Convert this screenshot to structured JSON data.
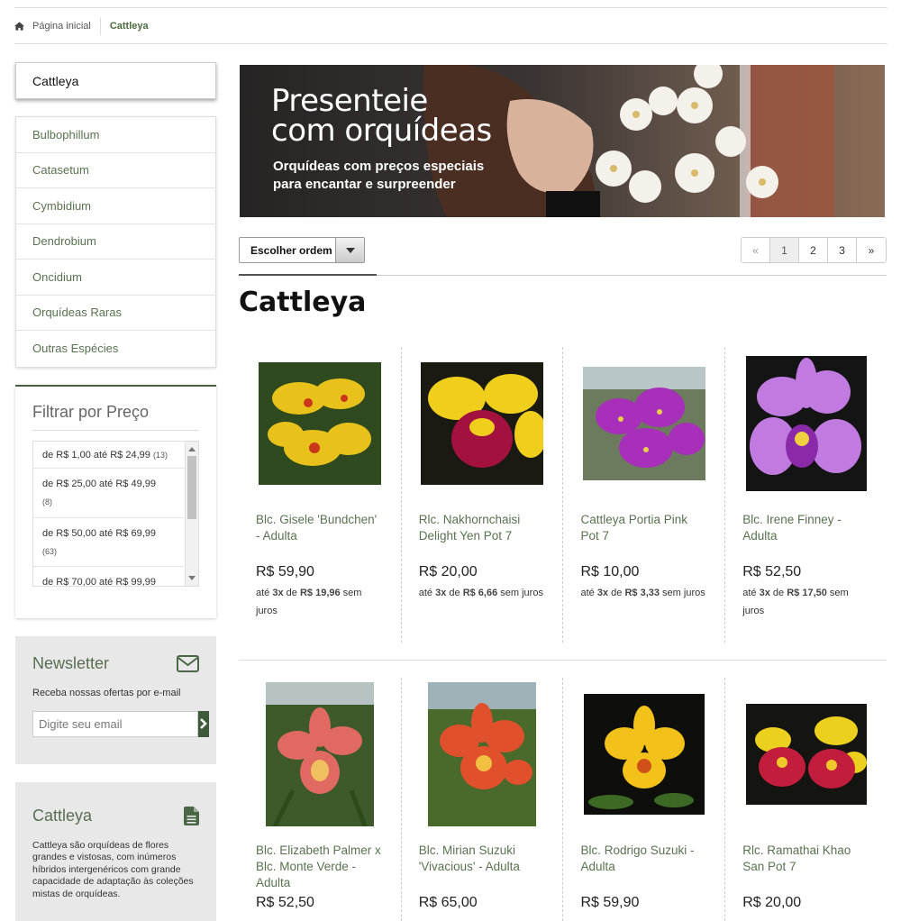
{
  "breadcrumb": {
    "home": "Página inicial",
    "current": "Cattleya"
  },
  "sidebar": {
    "category_title": "Cattleya",
    "categories": [
      "Bulbophillum",
      "Catasetum",
      "Cymbidium",
      "Dendrobium",
      "Oncidium",
      "Orquídeas Raras",
      "Outras Espécies"
    ],
    "filter": {
      "title": "Filtrar por Preço",
      "items": [
        {
          "label": "de R$ 1,00 até R$ 24,99",
          "count": "(13)"
        },
        {
          "label": "de R$ 25,00 até R$ 49,99",
          "count": "(8)"
        },
        {
          "label": "de R$ 50,00 até R$ 69,99",
          "count": "(63)"
        },
        {
          "label": "de R$ 70,00 até R$ 99,99",
          "count": ""
        }
      ]
    },
    "newsletter": {
      "title": "Newsletter",
      "text": "Receba nossas ofertas por e-mail",
      "placeholder": "Digite seu email"
    },
    "info": {
      "title": "Cattleya",
      "text": "Cattleya são orquídeas de flores grandes e vistosas, com inúmeros híbridos intergenéricos com grande capacidade de adaptação às coleções mistas de orquídeas."
    }
  },
  "banner": {
    "headline_1": "Presenteie",
    "headline_2": "com orquídeas",
    "sub_1": "Orquídeas com preços especiais",
    "sub_2": "para encantar e surpreender"
  },
  "toolbar": {
    "sort_label": "Escolher ordem",
    "pager": [
      "«",
      "1",
      "2",
      "3",
      "»"
    ]
  },
  "page_title": "Cattleya",
  "products": [
    {
      "name": "Blc. Gisele 'Bundchen' - Adulta",
      "price": "R$ 59,90",
      "inst_pre": "até ",
      "inst_n": "3x",
      "inst_mid": " de ",
      "inst_val": "R$ 19,96",
      "inst_post": " sem juros"
    },
    {
      "name": "Rlc. Nakhornchaisi Delight Yen Pot 7",
      "price": "R$ 20,00",
      "inst_pre": "até ",
      "inst_n": "3x",
      "inst_mid": " de ",
      "inst_val": "R$ 6,66",
      "inst_post": " sem juros"
    },
    {
      "name": "Cattleya Portia Pink Pot 7",
      "price": "R$ 10,00",
      "inst_pre": "até ",
      "inst_n": "3x",
      "inst_mid": " de ",
      "inst_val": "R$ 3,33",
      "inst_post": " sem juros"
    },
    {
      "name": "Blc. Irene Finney - Adulta",
      "price": "R$ 52,50",
      "inst_pre": "até ",
      "inst_n": "3x",
      "inst_mid": " de ",
      "inst_val": "R$ 17,50",
      "inst_post": " sem juros"
    },
    {
      "name": "Blc. Elizabeth Palmer x Blc. Monte Verde - Adulta",
      "price": "R$ 52,50"
    },
    {
      "name": "Blc. Mirian Suzuki 'Vivacious' - Adulta",
      "price": "R$ 65,00"
    },
    {
      "name": "Blc. Rodrigo Suzuki - Adulta",
      "price": "R$ 59,90"
    },
    {
      "name": "Rlc. Ramathai Khao San Pot 7",
      "price": "R$ 20,00"
    }
  ],
  "colors": {
    "accent_green": "#3e5a3a",
    "link_green": "#5a7250"
  },
  "icons": [
    "home-icon",
    "mail-icon",
    "document-icon",
    "chevron-right-icon",
    "sort-dropdown-arrow"
  ]
}
